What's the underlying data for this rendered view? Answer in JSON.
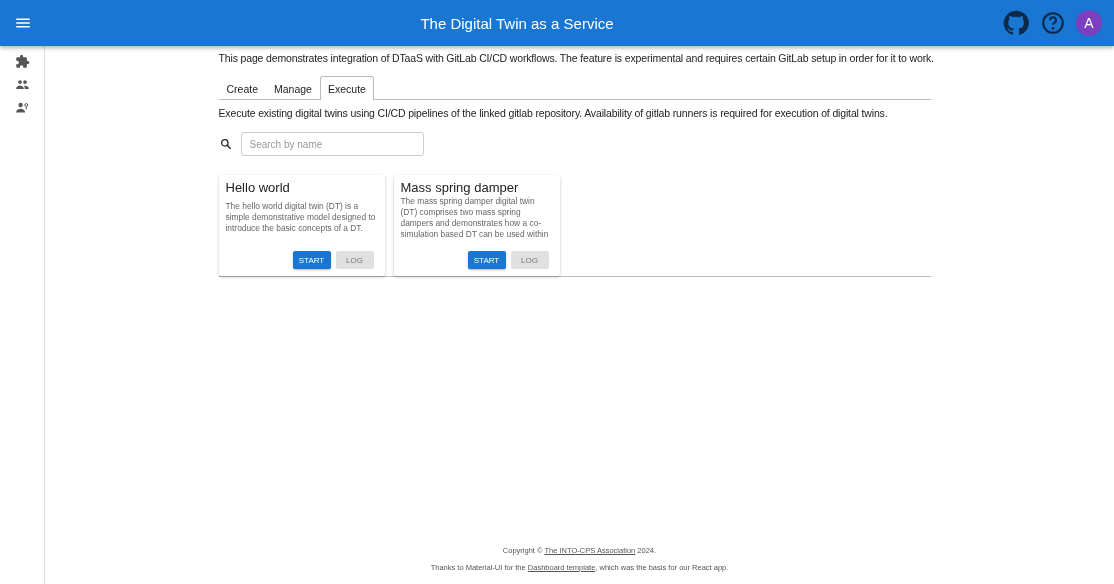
{
  "app_bar": {
    "title": "The Digital Twin as a Service",
    "avatar": "A"
  },
  "sidebar": {
    "items": [
      {
        "kind": "plugin"
      },
      {
        "kind": "users"
      },
      {
        "kind": "user-settings"
      }
    ]
  },
  "intro": "This page demonstrates integration of DTaaS with GitLab CI/CD workflows. The feature is experimental and requires certain GitLab setup in order for it to work.",
  "tabs": [
    {
      "label": "Create",
      "selected": false
    },
    {
      "label": "Manage",
      "selected": false
    },
    {
      "label": "Execute",
      "selected": true
    }
  ],
  "tab_description": "Execute existing digital twins using CI/CD pipelines of the linked gitlab repository. Availability of gitlab runners is required for execution of digital twins.",
  "search": {
    "placeholder": "Search by name"
  },
  "cards": [
    {
      "title": "Hello world",
      "description": "The hello world digital twin (DT) is a simple demonstrative model designed to introduce the basic concepts of a DT.",
      "buttons": [
        {
          "label": "START",
          "disabled": false
        },
        {
          "label": "LOG",
          "disabled": true
        }
      ]
    },
    {
      "title": "Mass spring damper",
      "description": "The mass spring damper digital twin (DT) comprises two mass spring dampers and demonstrates how a co-simulation based DT can be used within",
      "buttons": [
        {
          "label": "START",
          "disabled": false
        },
        {
          "label": "LOG",
          "disabled": true
        }
      ]
    }
  ],
  "footer": {
    "lines": [
      {
        "before": "Copyright © ",
        "link": "The INTO-CPS Association",
        "after": " 2024."
      },
      {
        "before": "Thanks to Material-UI for the ",
        "link": "Dashboard template",
        "after": ", which was the basis for our React app."
      }
    ]
  }
}
